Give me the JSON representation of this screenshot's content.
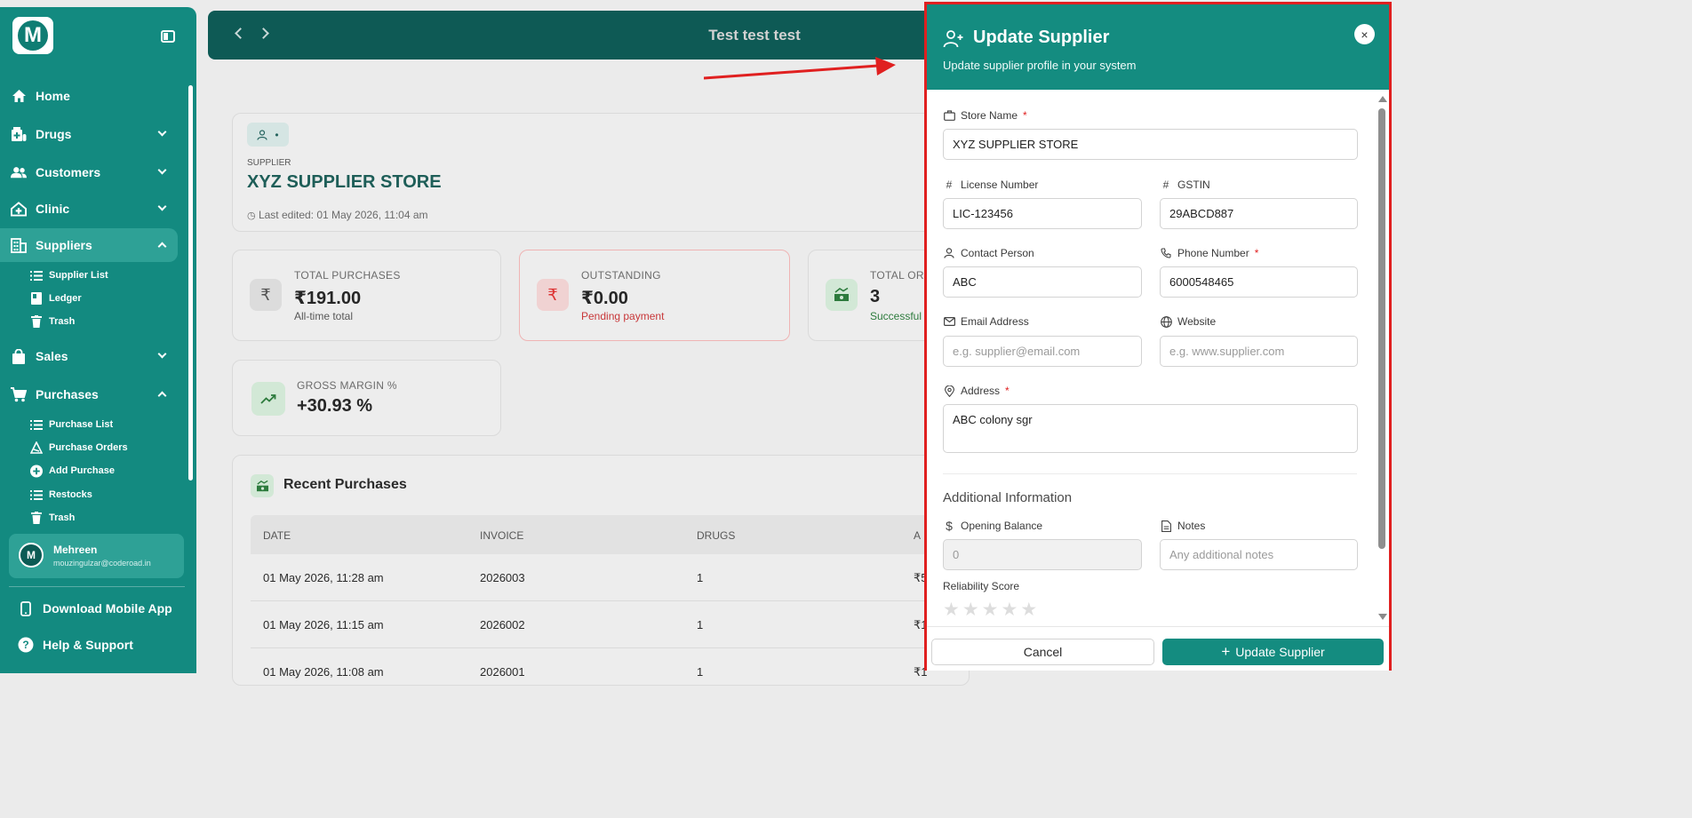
{
  "sidebar": {
    "logo_letter": "M",
    "items": [
      {
        "label": "Home"
      },
      {
        "label": "Drugs"
      },
      {
        "label": "Customers"
      },
      {
        "label": "Clinic"
      },
      {
        "label": "Suppliers"
      },
      {
        "label": "Sales"
      },
      {
        "label": "Purchases"
      }
    ],
    "supplier_sub": [
      "Supplier List",
      "Ledger",
      "Trash"
    ],
    "purchases_sub": [
      "Purchase List",
      "Purchase Orders",
      "Add Purchase",
      "Restocks",
      "Trash"
    ],
    "user": {
      "initial": "M",
      "name": "Mehreen",
      "email": "mouzingulzar@coderoad.in"
    },
    "download_app": "Download Mobile App",
    "help": "Help & Support"
  },
  "topbar": {
    "title": "Test test test"
  },
  "supplier": {
    "label": "SUPPLIER",
    "name": "XYZ SUPPLIER STORE",
    "last_edited": "Last edited: 01 May 2026, 11:04 am",
    "badge_dot": "•"
  },
  "stats": [
    {
      "label": "TOTAL PURCHASES",
      "value": "₹191.00",
      "sub": "All-time total",
      "icon": "₹"
    },
    {
      "label": "OUTSTANDING",
      "value": "₹0.00",
      "sub": "Pending payment",
      "icon": "₹"
    },
    {
      "label": "TOTAL OR",
      "value": "3",
      "sub": "Successful",
      "icon": "cash-icon"
    },
    {
      "label": "GROSS MARGIN %",
      "value": "+30.93 %",
      "sub": "",
      "icon": "trend-up-icon"
    }
  ],
  "recent": {
    "title": "Recent Purchases",
    "columns": [
      "DATE",
      "INVOICE",
      "DRUGS",
      "A"
    ],
    "rows": [
      {
        "date": "01 May 2026, 11:28 am",
        "invoice": "2026003",
        "drugs": "1",
        "amount": "₹5"
      },
      {
        "date": "01 May 2026, 11:15 am",
        "invoice": "2026002",
        "drugs": "1",
        "amount": "₹1"
      },
      {
        "date": "01 May 2026, 11:08 am",
        "invoice": "2026001",
        "drugs": "1",
        "amount": "₹1"
      }
    ]
  },
  "drawer": {
    "title": "Update Supplier",
    "subtitle": "Update supplier profile in your system",
    "close": "×",
    "fields": {
      "store_name": {
        "label": "Store Name",
        "value": "XYZ SUPPLIER STORE"
      },
      "license": {
        "label": "License Number",
        "value": "LIC-123456"
      },
      "gstin": {
        "label": "GSTIN",
        "value": "29ABCD887"
      },
      "contact": {
        "label": "Contact Person",
        "value": "ABC"
      },
      "phone": {
        "label": "Phone Number",
        "value": "6000548465"
      },
      "email": {
        "label": "Email Address",
        "placeholder": "e.g. supplier@email.com"
      },
      "website": {
        "label": "Website",
        "placeholder": "e.g. www.supplier.com"
      },
      "address": {
        "label": "Address",
        "value": "ABC colony sgr"
      }
    },
    "additional": {
      "title": "Additional Information",
      "opening_balance": {
        "label": "Opening Balance",
        "placeholder": "0"
      },
      "notes": {
        "label": "Notes",
        "placeholder": "Any additional notes"
      },
      "reliability": {
        "label": "Reliability Score",
        "stars": 5,
        "value": 0
      }
    },
    "required_mark": "*",
    "cancel": "Cancel",
    "update": "Update Supplier"
  },
  "colors": {
    "primary": "#148c80",
    "sidebar": "#138a80",
    "highlight": "#e02020"
  }
}
